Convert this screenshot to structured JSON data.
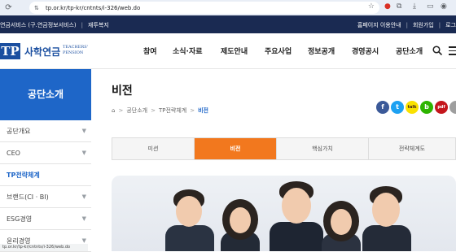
{
  "browser": {
    "url": "tp.or.kr/tp-kr/cntnts/i-326/web.do",
    "status_url": "tp.or.kr/tp-kr/cntnts/i-326/web.do"
  },
  "utility_bar": {
    "left_link": "연금서비스 (구.연금정보서비스)",
    "left_link2": "재투복지",
    "right_link1": "홈페이지 이용안내",
    "right_link2": "회원가입",
    "right_link3": "로그"
  },
  "header": {
    "logo_mark": "TP",
    "logo_name": "사학연금",
    "logo_sub1": "TEACHERS'",
    "logo_sub2": "PENSION",
    "nav": [
      "참여",
      "소식·자료",
      "제도안내",
      "주요사업",
      "정보공개",
      "경영공시",
      "공단소개"
    ]
  },
  "sidebar": {
    "title": "공단소개",
    "items": [
      {
        "label": "공단개요",
        "active": false,
        "chevron": true
      },
      {
        "label": "CEO",
        "active": false,
        "chevron": true
      },
      {
        "label": "TP전략체계",
        "active": true,
        "chevron": false
      },
      {
        "label": "브랜드(CI · BI)",
        "active": false,
        "chevron": true
      },
      {
        "label": "ESG경영",
        "active": false,
        "chevron": true
      },
      {
        "label": "윤리경영",
        "active": false,
        "chevron": true
      }
    ]
  },
  "content": {
    "title": "비전",
    "breadcrumb": [
      "공단소개",
      "TP전략체계",
      "비전"
    ],
    "tabs": [
      "미션",
      "비전",
      "핵심가치",
      "전략체계도"
    ],
    "active_tab": 1
  },
  "share": {
    "facebook": "f",
    "twitter": "t",
    "kakao": "talk",
    "blog": "b",
    "pdf": "pdf",
    "print": "P",
    "more": "+"
  },
  "colors": {
    "brand_blue": "#1e66c8",
    "navy": "#1a2a52",
    "tab_orange": "#f2781e"
  }
}
